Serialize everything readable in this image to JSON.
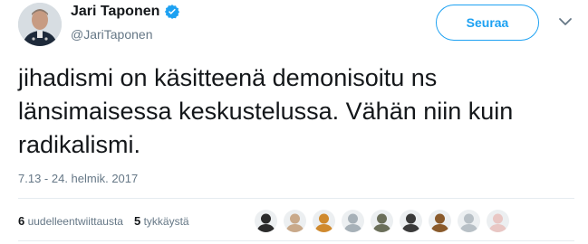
{
  "author": {
    "display_name": "Jari Taponen",
    "handle": "@JariTaponen",
    "verified": true,
    "avatar_icon": "profile-photo"
  },
  "actions": {
    "follow_label": "Seuraa",
    "menu_icon": "chevron-down-icon"
  },
  "tweet": {
    "text": "jihadismi on käsitteenä demonisoitu ns länsimaisessa keskustelussa. Vähän niin kuin radikalismi.",
    "timestamp": "7.13 - 24. helmik. 2017"
  },
  "stats": {
    "retweets_count": "6",
    "retweets_label": "uudelleentwiittausta",
    "likes_count": "5",
    "likes_label": "tykkäystä"
  },
  "likers": [
    {
      "icon": "liker-avatar-1",
      "color": "#2b2b2b"
    },
    {
      "icon": "liker-avatar-2",
      "color": "#c9a98a"
    },
    {
      "icon": "liker-avatar-3",
      "color": "#d08a2e"
    },
    {
      "icon": "liker-avatar-4",
      "color": "#a7b1b8"
    },
    {
      "icon": "liker-avatar-5",
      "color": "#6b6f5a"
    },
    {
      "icon": "liker-avatar-6",
      "color": "#3a3a3a"
    },
    {
      "icon": "liker-avatar-7",
      "color": "#8a5a2b"
    },
    {
      "icon": "liker-avatar-8",
      "color": "#b8c0c6"
    },
    {
      "icon": "liker-avatar-9",
      "color": "#e9c7c4"
    }
  ],
  "colors": {
    "accent": "#1da1f2",
    "text_primary": "#14171a",
    "text_secondary": "#657786"
  }
}
